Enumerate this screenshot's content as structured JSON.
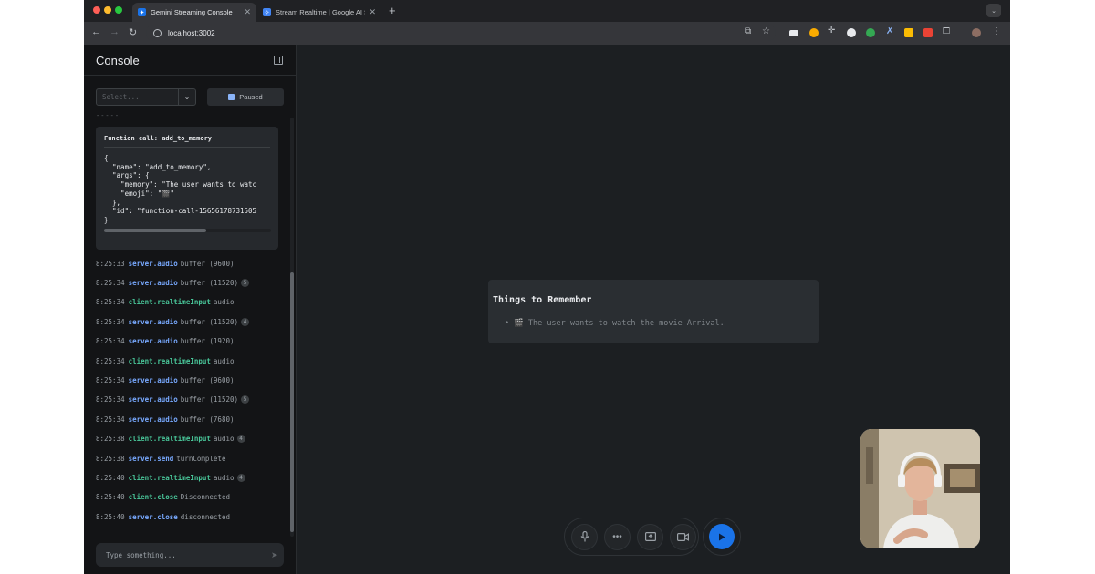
{
  "browser": {
    "tabs": [
      {
        "title": "Gemini Streaming Console",
        "active": true
      },
      {
        "title": "Stream Realtime | Google AI Stud",
        "active": false
      }
    ],
    "url": "localhost:3002"
  },
  "console": {
    "title": "Console",
    "select_placeholder": "Select...",
    "pause_label": "Paused",
    "separator": "-----",
    "function_call": {
      "title": "Function call: add_to_memory",
      "code_lines": [
        "{",
        "  \"name\": \"add_to_memory\",",
        "  \"args\": {",
        "    \"memory\": \"The user wants to watc",
        "    \"emoji\": \"🎬\"",
        "  },",
        "  \"id\": \"function-call-15656178731505",
        "}"
      ]
    },
    "logs": [
      {
        "time": "8:25:33",
        "source": "server.audio",
        "kind": "server",
        "message": "buffer (9600)",
        "badge": ""
      },
      {
        "time": "8:25:34",
        "source": "server.audio",
        "kind": "server",
        "message": "buffer (11520)",
        "badge": "5"
      },
      {
        "time": "8:25:34",
        "source": "client.realtimeInput",
        "kind": "client",
        "message": "audio",
        "badge": ""
      },
      {
        "time": "8:25:34",
        "source": "server.audio",
        "kind": "server",
        "message": "buffer (11520)",
        "badge": "4"
      },
      {
        "time": "8:25:34",
        "source": "server.audio",
        "kind": "server",
        "message": "buffer (1920)",
        "badge": ""
      },
      {
        "time": "8:25:34",
        "source": "client.realtimeInput",
        "kind": "client",
        "message": "audio",
        "badge": ""
      },
      {
        "time": "8:25:34",
        "source": "server.audio",
        "kind": "server",
        "message": "buffer (9600)",
        "badge": ""
      },
      {
        "time": "8:25:34",
        "source": "server.audio",
        "kind": "server",
        "message": "buffer (11520)",
        "badge": "5"
      },
      {
        "time": "8:25:34",
        "source": "server.audio",
        "kind": "server",
        "message": "buffer (7680)",
        "badge": ""
      },
      {
        "time": "8:25:38",
        "source": "client.realtimeInput",
        "kind": "client",
        "message": "audio",
        "badge": "4"
      },
      {
        "time": "8:25:38",
        "source": "server.send",
        "kind": "server",
        "message": "turnComplete",
        "badge": ""
      },
      {
        "time": "8:25:40",
        "source": "client.realtimeInput",
        "kind": "client",
        "message": "audio",
        "badge": "4"
      },
      {
        "time": "8:25:40",
        "source": "client.close",
        "kind": "client",
        "message": "Disconnected",
        "badge": ""
      },
      {
        "time": "8:25:40",
        "source": "server.close",
        "kind": "server",
        "message": "disconnected",
        "badge": ""
      }
    ],
    "input_placeholder": "Type something..."
  },
  "memory_panel": {
    "title": "Things to Remember",
    "items": [
      {
        "emoji": "🎬",
        "text": "The user wants to watch the movie Arrival."
      }
    ]
  },
  "colors": {
    "server_source": "#78a9ff",
    "client_source": "#49c79a",
    "play_button": "#1a73e8"
  }
}
